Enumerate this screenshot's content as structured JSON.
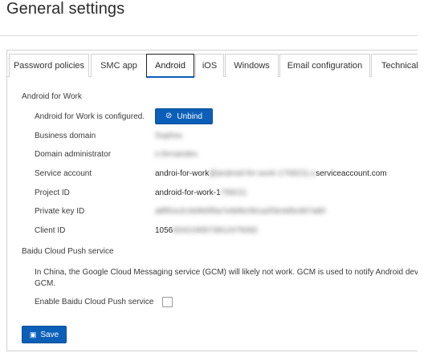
{
  "page": {
    "title": "General settings"
  },
  "tabs": [
    {
      "label": "Password policies"
    },
    {
      "label": "SMC app"
    },
    {
      "label": "Android",
      "active": true
    },
    {
      "label": "iOS"
    },
    {
      "label": "Windows"
    },
    {
      "label": "Email configuration"
    },
    {
      "label": "Technical"
    }
  ],
  "android_for_work": {
    "section_title": "Android for Work",
    "status_label": "Android for Work is configured.",
    "unbind_label": "Unbind",
    "fields": [
      {
        "label": "Business domain",
        "value": "Sophos"
      },
      {
        "label": "Domain administrator",
        "value": "n.fernandes"
      },
      {
        "label": "Service account",
        "value_visible_start": "androi-for-work",
        "value_redacted": "@android-for-work-1758211.iam.g",
        "value_visible_end": "serviceaccount.com"
      },
      {
        "label": "Project ID",
        "value_visible_start": "android-for-work-1",
        "value_redacted": "758211"
      },
      {
        "label": "Private key ID",
        "value_redacted": "a8f91e2c3d4b5f6a7e8d9c0b1a2f3e4d5c6b7a80"
      },
      {
        "label": "Client ID",
        "value_visible_start": "1056",
        "value_redacted": "8342190573812475092"
      }
    ]
  },
  "baidu": {
    "section_title": "Baidu Cloud Push service",
    "description": "In China, the Google Cloud Messaging service (GCM) will likely not work. GCM is used to notify Android devices about changes in the app GCM.",
    "description_line1": "In China, the Google Cloud Messaging service (GCM) will likely not work. GCM is used to notify Android dev",
    "description_line2": "GCM.",
    "enable_label": "Enable Baidu Cloud Push service",
    "enabled": false
  },
  "actions": {
    "save_label": "Save"
  },
  "colors": {
    "primary": "#0b5fb8",
    "border": "#d2d2d2",
    "text": "#3a3a3a"
  },
  "icons": {
    "unbind": "ban-icon",
    "save": "floppy-disk-icon"
  }
}
